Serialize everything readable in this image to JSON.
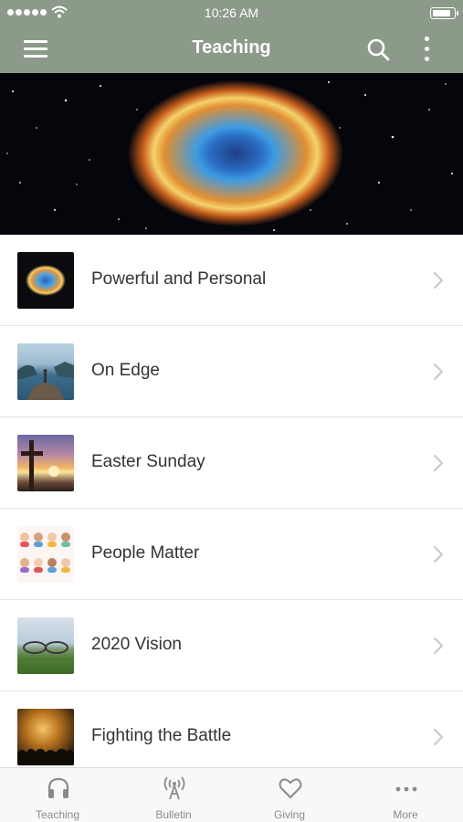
{
  "status_bar": {
    "time": "10:26 AM",
    "battery_level": 0.9
  },
  "nav": {
    "title": "Teaching",
    "icons": {
      "menu": "hamburger-menu-icon",
      "search": "search-icon",
      "more": "more-vertical-icon"
    }
  },
  "hero": {
    "image": "supernova-nebula"
  },
  "list": {
    "items": [
      {
        "label": "Powerful and Personal",
        "thumbnail": "nebula"
      },
      {
        "label": "On Edge",
        "thumbnail": "person-on-cliff-over-sea"
      },
      {
        "label": "Easter Sunday",
        "thumbnail": "cross-at-sunset"
      },
      {
        "label": "People Matter",
        "thumbnail": "illustrated-faces"
      },
      {
        "label": "2020 Vision",
        "thumbnail": "eyeglasses-over-field"
      },
      {
        "label": "Fighting the Battle",
        "thumbnail": "crowd-with-lights"
      }
    ]
  },
  "tab_bar": {
    "active_color": "#8a8a8a",
    "tabs": [
      {
        "label": "Teaching",
        "icon": "headphones-icon"
      },
      {
        "label": "Bulletin",
        "icon": "broadcast-tower-icon"
      },
      {
        "label": "Giving",
        "icon": "heart-icon"
      },
      {
        "label": "More",
        "icon": "more-horizontal-icon"
      }
    ]
  },
  "theme": {
    "nav_color": "#8c9a8a",
    "text_color": "#333333"
  }
}
